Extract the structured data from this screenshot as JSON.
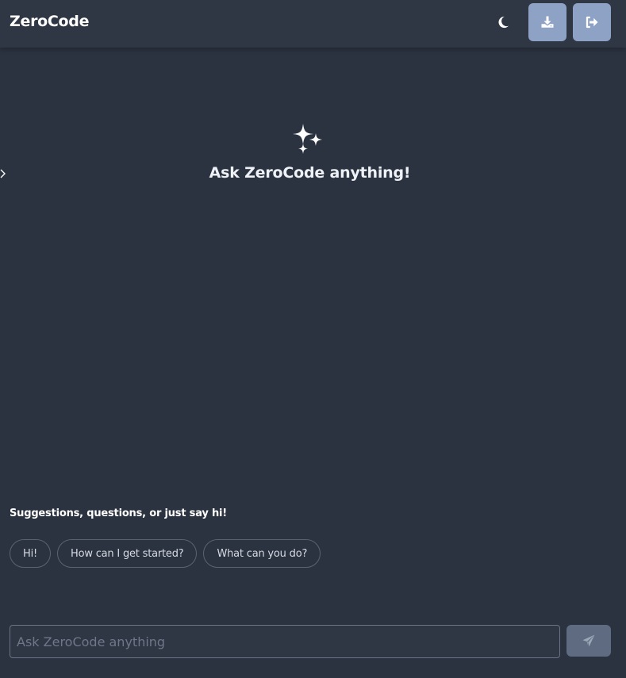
{
  "header": {
    "title": "ZeroCode",
    "theme_toggle_icon": "moon-icon",
    "download_icon": "download-icon",
    "logout_icon": "logout-icon",
    "accent_color": "#8ea2c5"
  },
  "sidebar": {
    "toggle_icon": "chevron-right-icon"
  },
  "hero": {
    "icon": "sparkles-icon",
    "title": "Ask ZeroCode anything!"
  },
  "suggestions": {
    "heading": "Suggestions, questions, or just say hi!",
    "items": [
      {
        "label": "Hi!"
      },
      {
        "label": "How can I get started?"
      },
      {
        "label": "What can you do?"
      }
    ]
  },
  "composer": {
    "placeholder": "Ask ZeroCode anything",
    "value": "",
    "send_icon": "send-icon"
  },
  "colors": {
    "background": "#2b3240",
    "header": "#2f3644",
    "send_button": "#5e6b81"
  }
}
